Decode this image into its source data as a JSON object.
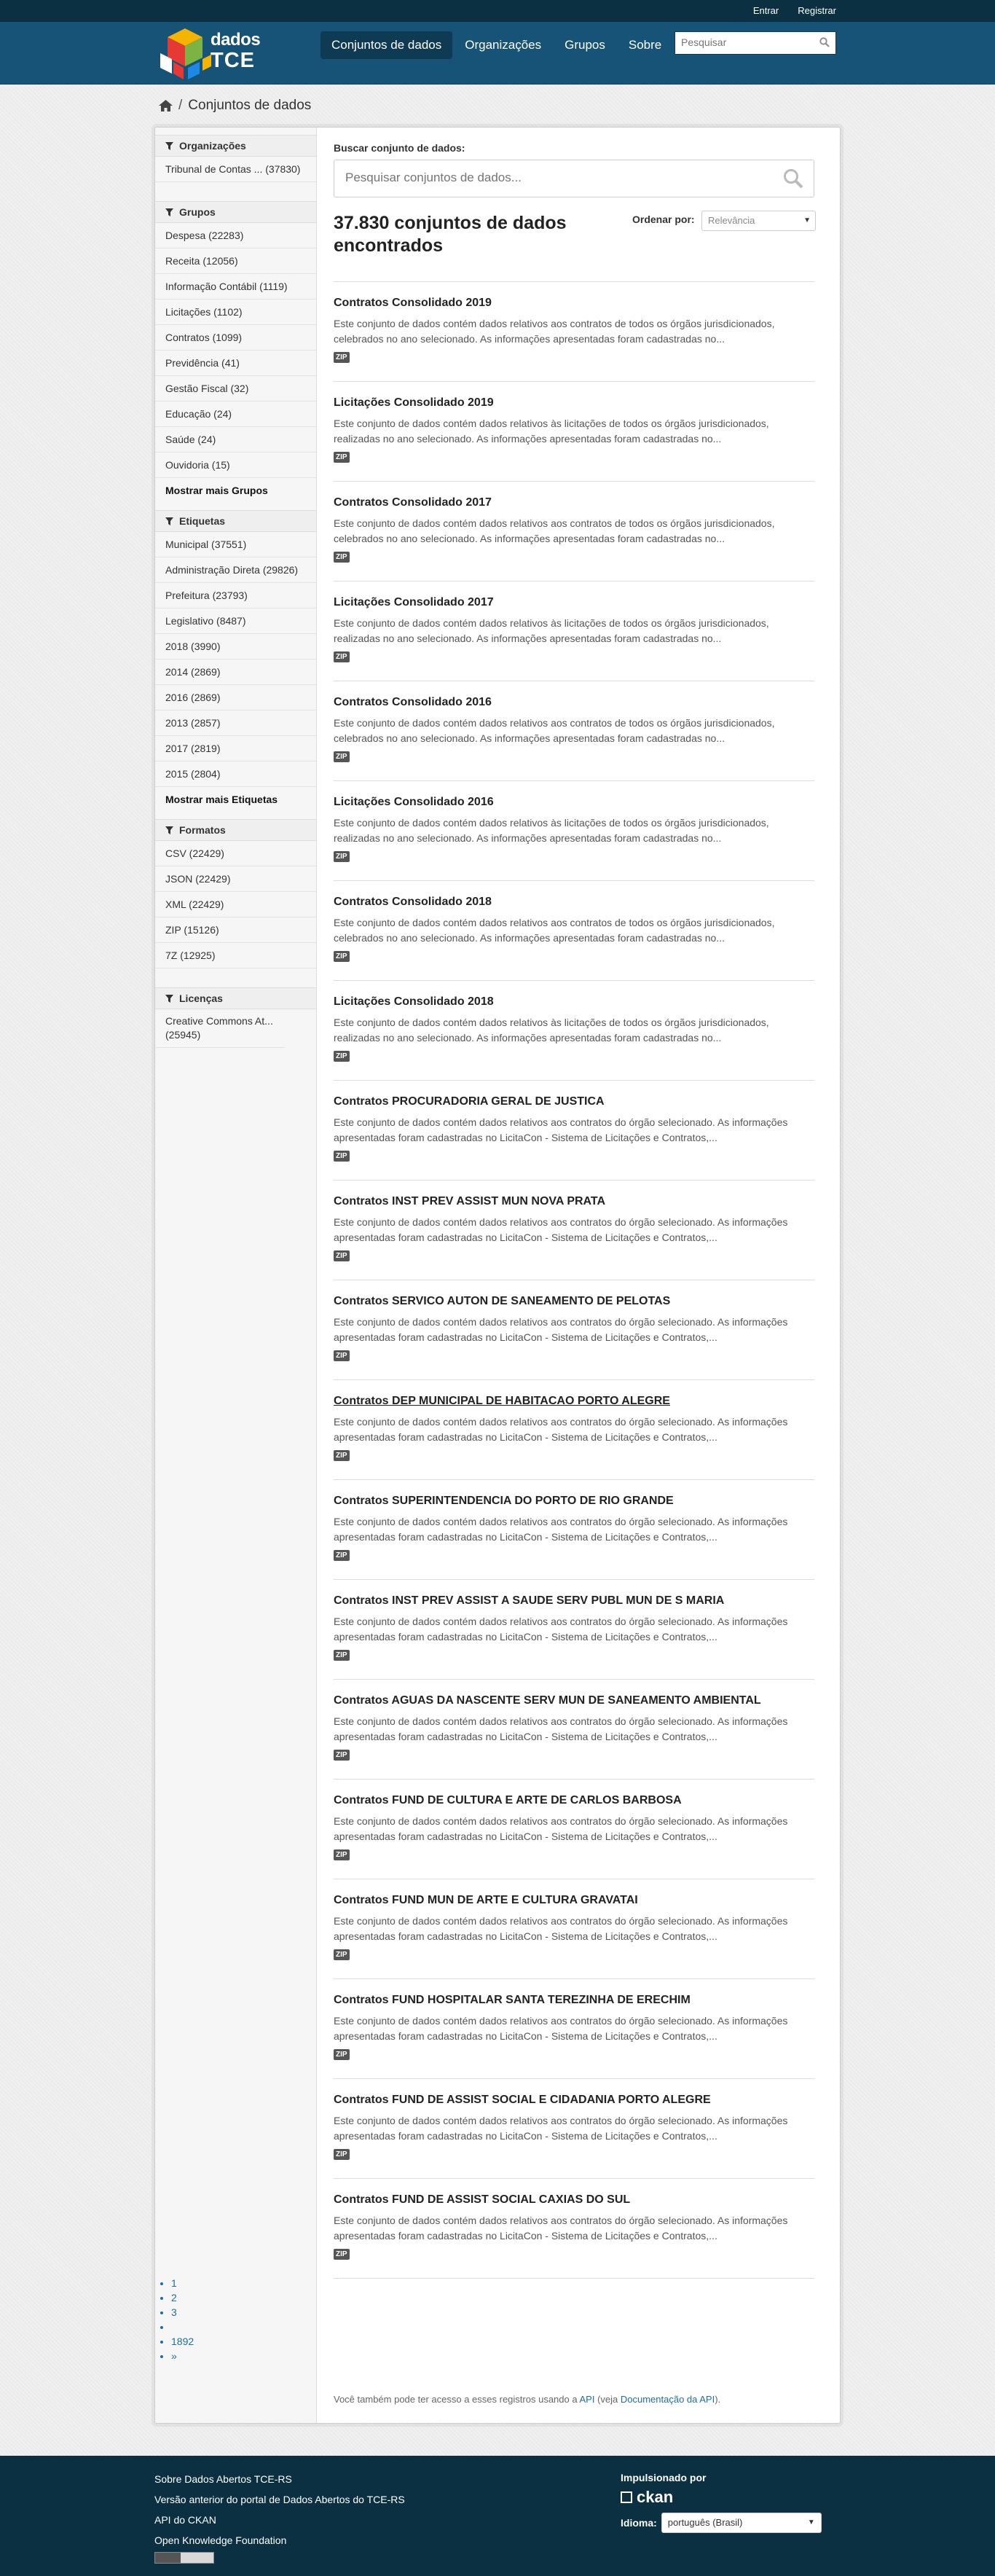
{
  "account": {
    "login": "Entrar",
    "register": "Registrar"
  },
  "logo": {
    "line1": "dados",
    "line2": "TCE"
  },
  "nav": [
    {
      "label": "Conjuntos de dados",
      "active": true
    },
    {
      "label": "Organizações",
      "active": false
    },
    {
      "label": "Grupos",
      "active": false
    },
    {
      "label": "Sobre",
      "active": false
    }
  ],
  "site_search": {
    "placeholder": "Pesquisar",
    "icon": "search-icon"
  },
  "breadcrumb": {
    "home_icon": "home-icon",
    "separator": "/",
    "current": "Conjuntos de dados"
  },
  "facets": {
    "organizations": {
      "title": "Organizações",
      "items": [
        "Tribunal de Contas ... (37830)"
      ]
    },
    "groups": {
      "title": "Grupos",
      "items": [
        "Despesa (22283)",
        "Receita (12056)",
        "Informação Contábil (1119)",
        "Licitações (1102)",
        "Contratos (1099)",
        "Previdência (41)",
        "Gestão Fiscal (32)",
        "Educação (24)",
        "Saúde (24)",
        "Ouvidoria (15)"
      ],
      "more": "Mostrar mais Grupos"
    },
    "tags": {
      "title": "Etiquetas",
      "items": [
        "Municipal (37551)",
        "Administração Direta (29826)",
        "Prefeitura (23793)",
        "Legislativo (8487)",
        "2018 (3990)",
        "2014 (2869)",
        "2016 (2869)",
        "2013 (2857)",
        "2017 (2819)",
        "2015 (2804)"
      ],
      "more": "Mostrar mais Etiquetas"
    },
    "formats": {
      "title": "Formatos",
      "items": [
        "CSV (22429)",
        "JSON (22429)",
        "XML (22429)",
        "ZIP (15126)",
        "7Z (12925)"
      ]
    },
    "licenses": {
      "title": "Licenças",
      "items": [
        "Creative Commons At... (25945)"
      ]
    }
  },
  "search": {
    "label": "Buscar conjunto de dados:",
    "placeholder": "Pesquisar conjuntos de dados...",
    "icon": "search-icon"
  },
  "results": {
    "count_text": "37.830 conjuntos de dados encontrados",
    "order_label": "Ordenar por:",
    "order_value": "Relevância"
  },
  "datasets": [
    {
      "title": "Contratos Consolidado 2019",
      "notes": "Este conjunto de dados contém dados relativos aos contratos de todos os órgãos jurisdicionados, celebrados no ano selecionado. As informações apresentadas foram cadastradas no...",
      "format": "ZIP",
      "underline": false
    },
    {
      "title": "Licitações Consolidado 2019",
      "notes": "Este conjunto de dados contém dados relativos às licitações de todos os órgãos jurisdicionados, realizadas no ano selecionado. As informações apresentadas foram cadastradas no...",
      "format": "ZIP",
      "underline": false
    },
    {
      "title": "Contratos Consolidado 2017",
      "notes": "Este conjunto de dados contém dados relativos aos contratos de todos os órgãos jurisdicionados, celebrados no ano selecionado. As informações apresentadas foram cadastradas no...",
      "format": "ZIP",
      "underline": false
    },
    {
      "title": "Licitações Consolidado 2017",
      "notes": "Este conjunto de dados contém dados relativos às licitações de todos os órgãos jurisdicionados, realizadas no ano selecionado. As informações apresentadas foram cadastradas no...",
      "format": "ZIP",
      "underline": false
    },
    {
      "title": "Contratos Consolidado 2016",
      "notes": "Este conjunto de dados contém dados relativos aos contratos de todos os órgãos jurisdicionados, celebrados no ano selecionado. As informações apresentadas foram cadastradas no...",
      "format": "ZIP",
      "underline": false
    },
    {
      "title": "Licitações Consolidado 2016",
      "notes": "Este conjunto de dados contém dados relativos às licitações de todos os órgãos jurisdicionados, realizadas no ano selecionado. As informações apresentadas foram cadastradas no...",
      "format": "ZIP",
      "underline": false
    },
    {
      "title": "Contratos Consolidado 2018",
      "notes": "Este conjunto de dados contém dados relativos aos contratos de todos os órgãos jurisdicionados, celebrados no ano selecionado. As informações apresentadas foram cadastradas no...",
      "format": "ZIP",
      "underline": false
    },
    {
      "title": "Licitações Consolidado 2018",
      "notes": "Este conjunto de dados contém dados relativos às licitações de todos os órgãos jurisdicionados, realizadas no ano selecionado. As informações apresentadas foram cadastradas no...",
      "format": "ZIP",
      "underline": false
    },
    {
      "title": "Contratos PROCURADORIA GERAL DE JUSTICA",
      "notes": "Este conjunto de dados contém dados relativos aos contratos do órgão selecionado. As informações apresentadas foram cadastradas no LicitaCon - Sistema de Licitações e Contratos,...",
      "format": "ZIP",
      "underline": false
    },
    {
      "title": "Contratos INST PREV ASSIST MUN NOVA PRATA",
      "notes": "Este conjunto de dados contém dados relativos aos contratos do órgão selecionado. As informações apresentadas foram cadastradas no LicitaCon - Sistema de Licitações e Contratos,...",
      "format": "ZIP",
      "underline": false
    },
    {
      "title": "Contratos SERVICO AUTON DE SANEAMENTO DE PELOTAS",
      "notes": "Este conjunto de dados contém dados relativos aos contratos do órgão selecionado. As informações apresentadas foram cadastradas no LicitaCon - Sistema de Licitações e Contratos,...",
      "format": "ZIP",
      "underline": false
    },
    {
      "title": "Contratos DEP MUNICIPAL DE HABITACAO PORTO ALEGRE",
      "notes": "Este conjunto de dados contém dados relativos aos contratos do órgão selecionado. As informações apresentadas foram cadastradas no LicitaCon - Sistema de Licitações e Contratos,...",
      "format": "ZIP",
      "underline": true
    },
    {
      "title": "Contratos SUPERINTENDENCIA DO PORTO DE RIO GRANDE",
      "notes": "Este conjunto de dados contém dados relativos aos contratos do órgão selecionado. As informações apresentadas foram cadastradas no LicitaCon - Sistema de Licitações e Contratos,...",
      "format": "ZIP",
      "underline": false
    },
    {
      "title": "Contratos INST PREV ASSIST A SAUDE SERV PUBL MUN DE S MARIA",
      "notes": "Este conjunto de dados contém dados relativos aos contratos do órgão selecionado. As informações apresentadas foram cadastradas no LicitaCon - Sistema de Licitações e Contratos,...",
      "format": "ZIP",
      "underline": false
    },
    {
      "title": "Contratos AGUAS DA NASCENTE SERV MUN DE SANEAMENTO AMBIENTAL",
      "notes": "Este conjunto de dados contém dados relativos aos contratos do órgão selecionado. As informações apresentadas foram cadastradas no LicitaCon - Sistema de Licitações e Contratos,...",
      "format": "ZIP",
      "underline": false
    },
    {
      "title": "Contratos FUND DE CULTURA E ARTE DE CARLOS BARBOSA",
      "notes": "Este conjunto de dados contém dados relativos aos contratos do órgão selecionado. As informações apresentadas foram cadastradas no LicitaCon - Sistema de Licitações e Contratos,...",
      "format": "ZIP",
      "underline": false
    },
    {
      "title": "Contratos FUND MUN DE ARTE E CULTURA GRAVATAI",
      "notes": "Este conjunto de dados contém dados relativos aos contratos do órgão selecionado. As informações apresentadas foram cadastradas no LicitaCon - Sistema de Licitações e Contratos,...",
      "format": "ZIP",
      "underline": false
    },
    {
      "title": "Contratos FUND HOSPITALAR SANTA TEREZINHA DE ERECHIM",
      "notes": "Este conjunto de dados contém dados relativos aos contratos do órgão selecionado. As informações apresentadas foram cadastradas no LicitaCon - Sistema de Licitações e Contratos,...",
      "format": "ZIP",
      "underline": false
    },
    {
      "title": "Contratos FUND DE ASSIST SOCIAL E CIDADANIA PORTO ALEGRE",
      "notes": "Este conjunto de dados contém dados relativos aos contratos do órgão selecionado. As informações apresentadas foram cadastradas no LicitaCon - Sistema de Licitações e Contratos,...",
      "format": "ZIP",
      "underline": false
    },
    {
      "title": "Contratos FUND DE ASSIST SOCIAL CAXIAS DO SUL",
      "notes": "Este conjunto de dados contém dados relativos aos contratos do órgão selecionado. As informações apresentadas foram cadastradas no LicitaCon - Sistema de Licitações e Contratos,...",
      "format": "ZIP",
      "underline": false
    }
  ],
  "pagination": [
    "1",
    "2",
    "3",
    "",
    "1892",
    "»"
  ],
  "api_note": {
    "before": "Você também pode ter acesso a esses registros usando a ",
    "api_link": "API",
    "middle": " (veja ",
    "doc_link": "Documentação da API",
    "after": ")."
  },
  "footer": {
    "links": [
      "Sobre Dados Abertos TCE-RS",
      "Versão anterior do portal de Dados Abertos do TCE-RS",
      "API do CKAN",
      "Open Knowledge Foundation"
    ],
    "powered_by": "Impulsionado por",
    "ckan": "ckan",
    "language_label": "Idioma:",
    "language_value": "português (Brasil)"
  },
  "colors": {
    "masthead": "#175277",
    "account_bar": "#0a3042",
    "footer": "#0a3042",
    "link": "#1f6ea1"
  }
}
